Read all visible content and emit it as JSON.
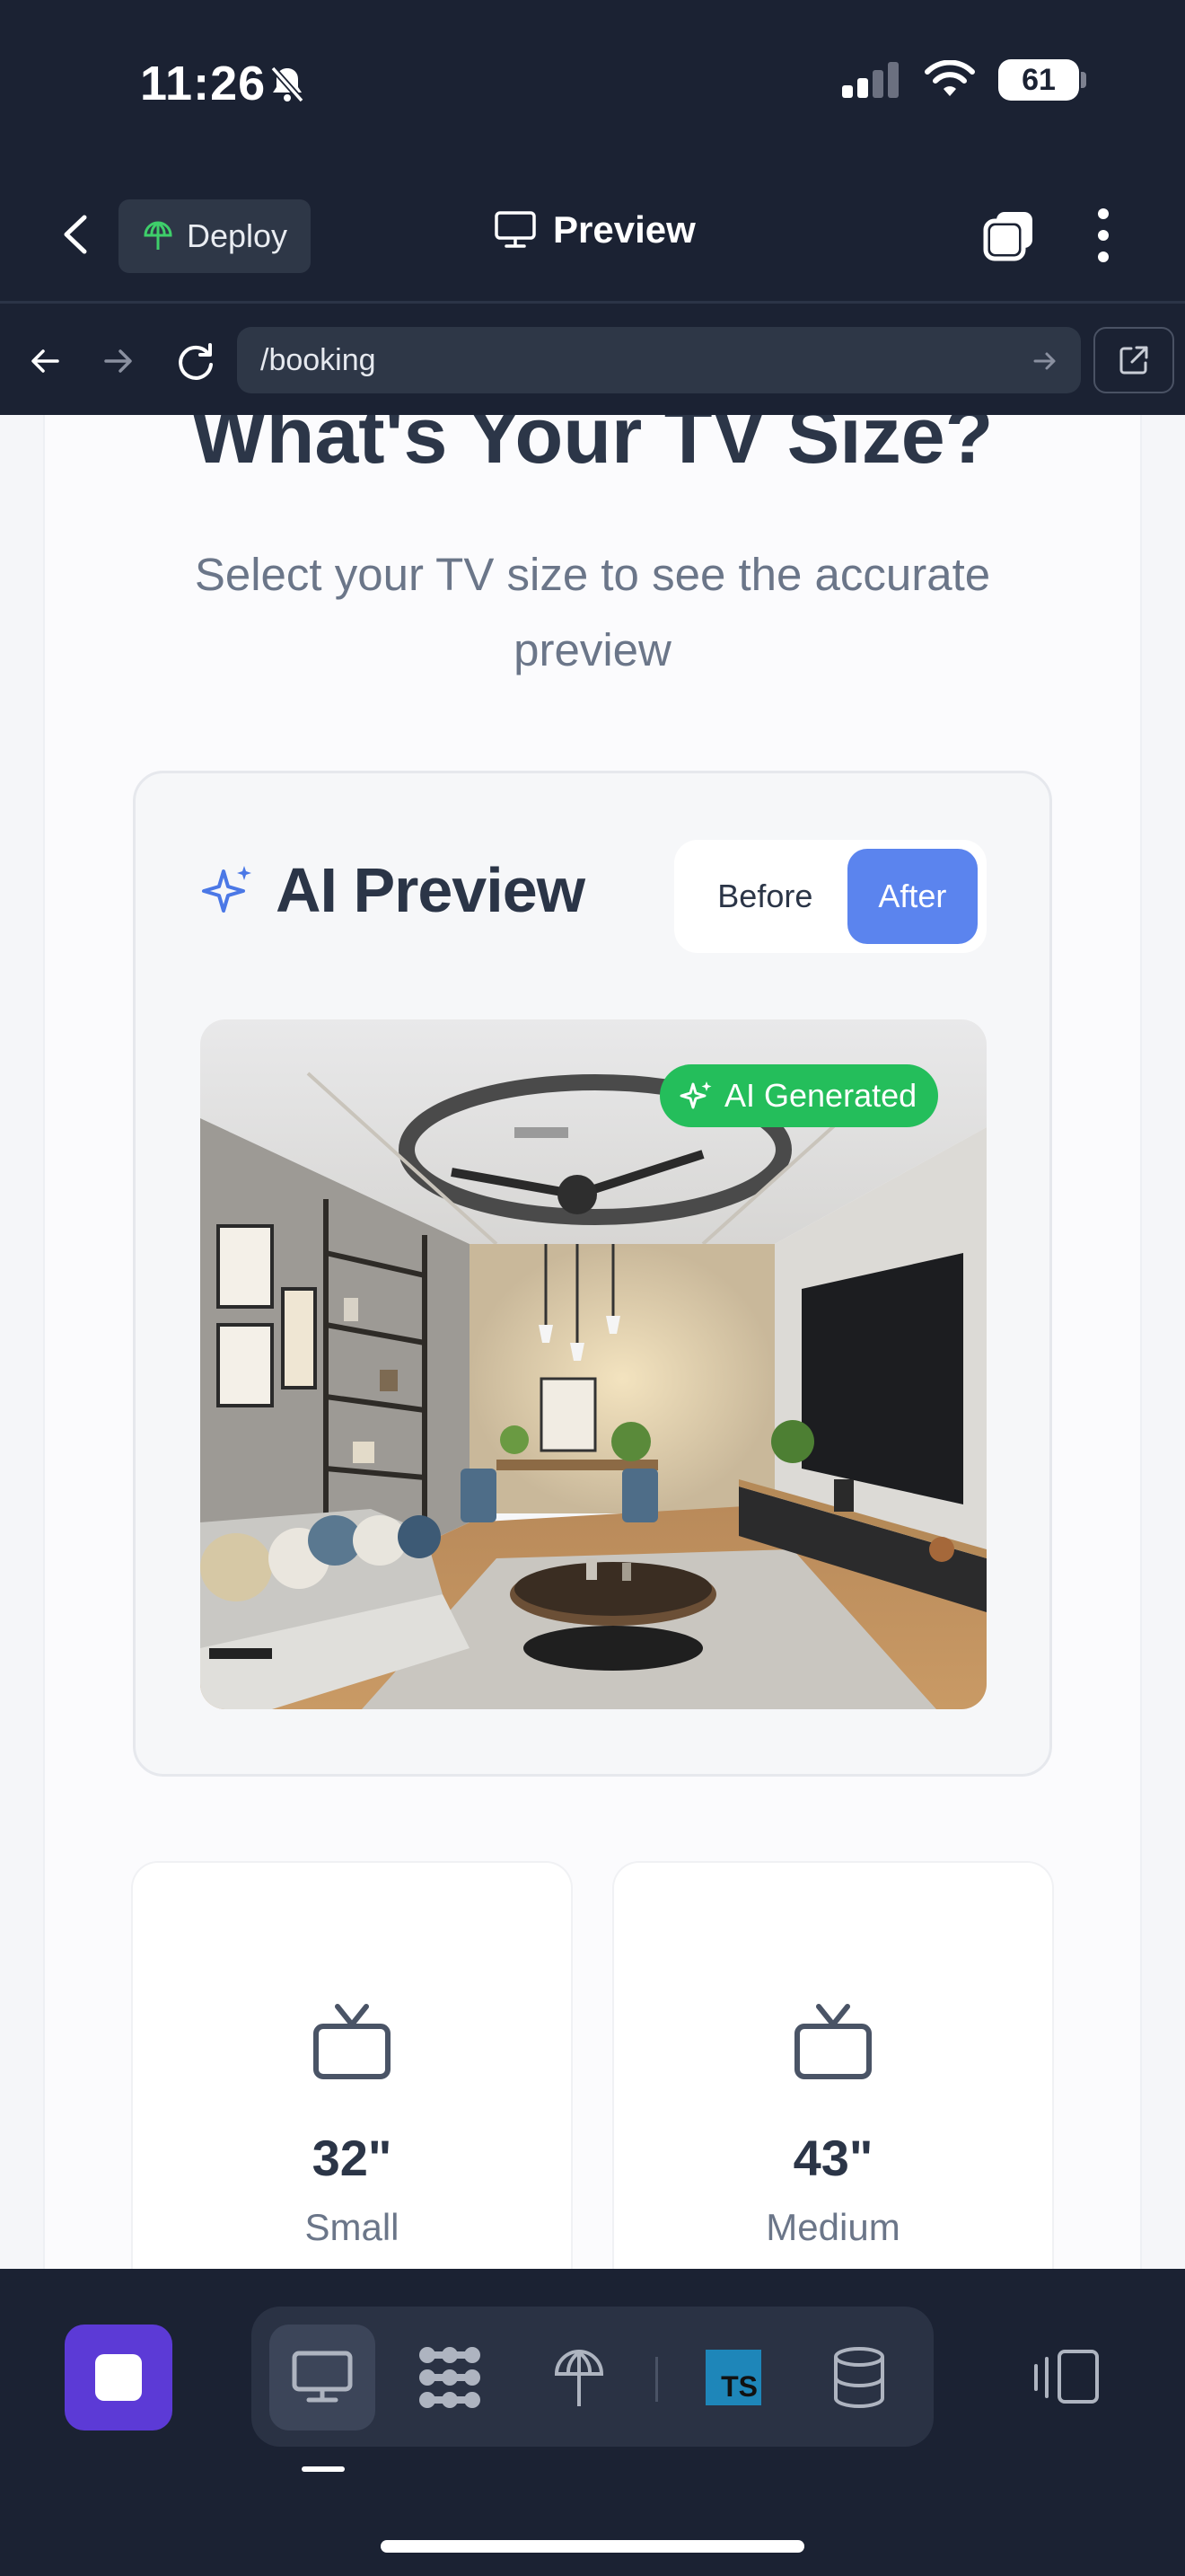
{
  "status_bar": {
    "time": "11:26",
    "battery": "61"
  },
  "app_bar": {
    "deploy_label": "Deploy",
    "title": "Preview"
  },
  "url_bar": {
    "path": "/booking"
  },
  "page": {
    "title": "What's Your TV Size?",
    "subtitle": "Select your TV size to see the accurate preview"
  },
  "ai_preview": {
    "title": "AI Preview",
    "toggle_before": "Before",
    "toggle_after": "After",
    "selected": "After",
    "badge": "AI Generated"
  },
  "tv_sizes": [
    {
      "size": "32\"",
      "label": "Small"
    },
    {
      "size": "43\"",
      "label": "Medium"
    }
  ],
  "colors": {
    "chrome_bg": "#1b2233",
    "accent_blue": "#5b84ee",
    "badge_green": "#24be5b",
    "stop_purple": "#5c3ad6"
  },
  "icons": {
    "dock_tools": [
      "monitor-icon",
      "grid-dots-icon",
      "deploy-icon",
      "typescript-icon",
      "database-icon"
    ]
  }
}
